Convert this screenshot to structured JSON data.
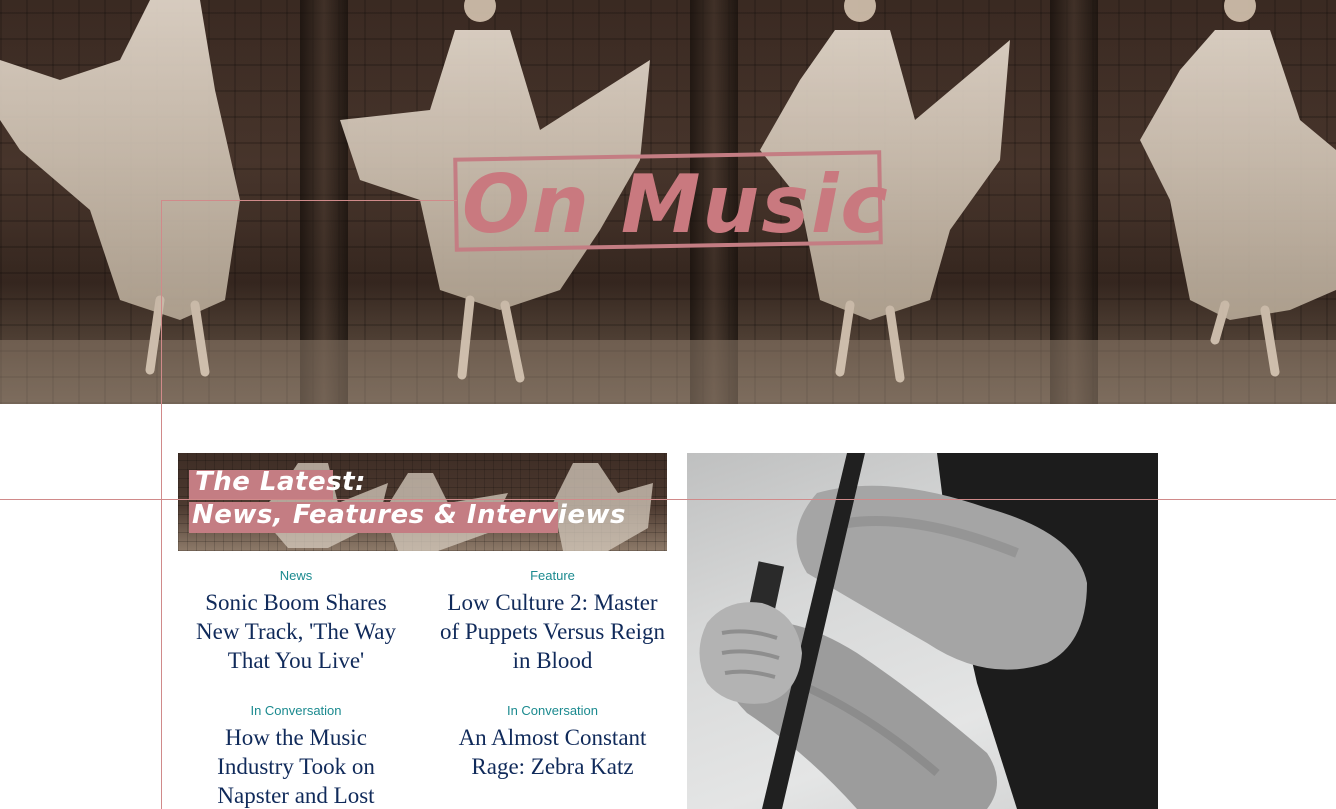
{
  "hero": {
    "title": "On Music",
    "accent_color": "#c9797f"
  },
  "banner": {
    "line1": "The Latest:",
    "line2": "News, Features & Interviews"
  },
  "posts": [
    {
      "category": "News",
      "title": "Sonic Boom Shares New Track, 'The Way That You Live'"
    },
    {
      "category": "Feature",
      "title": "Low Culture 2: Master of Puppets Versus Reign in Blood"
    },
    {
      "category": "In Conversation",
      "title": "How the Music Industry Took on Napster and Lost"
    },
    {
      "category": "In Conversation",
      "title": "An Almost Constant Rage: Zebra Katz"
    }
  ],
  "colors": {
    "category": "#1b8a8f",
    "post_title": "#102a5a",
    "guide_line": "#d08a8a"
  },
  "icons": {
    "hero_image": "dancer-photo",
    "feature_image": "microphone-stand-photo"
  }
}
